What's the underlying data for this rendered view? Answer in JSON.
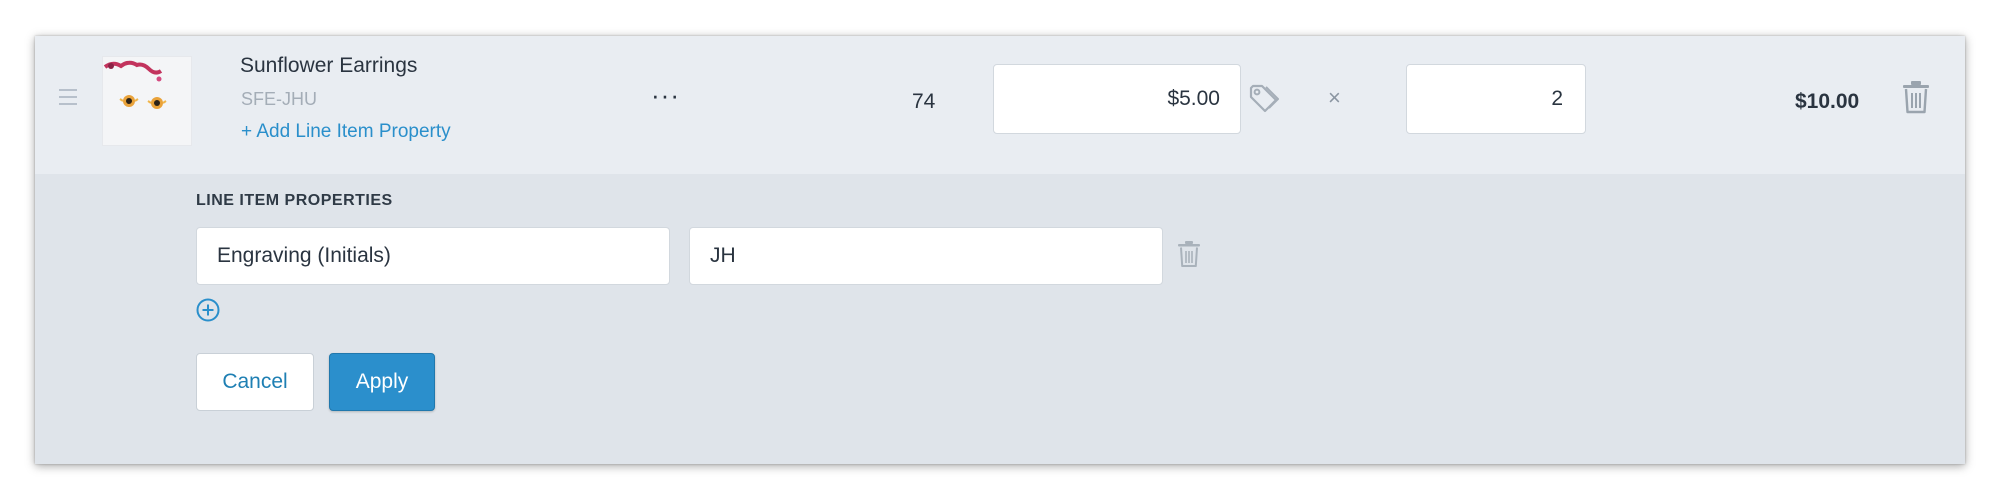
{
  "line_item": {
    "product_title": "Sunflower Earrings",
    "sku": "SFE-JHU",
    "add_property_link": "+ Add Line Item Property",
    "more_actions": "···",
    "available_qty": "74",
    "price": "$5.00",
    "multiply_symbol": "×",
    "quantity": "2",
    "line_total": "$10.00"
  },
  "properties_panel": {
    "section_title": "LINE ITEM PROPERTIES",
    "properties": [
      {
        "name": "Engraving (Initials)",
        "value": "JH"
      }
    ],
    "cancel_label": "Cancel",
    "apply_label": "Apply"
  },
  "icons": {
    "drag": "drag-handle-icon",
    "discount": "tag-icon",
    "delete": "trash-icon",
    "add": "plus-circle-icon"
  },
  "colors": {
    "accent": "#2b8fcc",
    "link": "#2a8fcb",
    "panel_bg": "#dfe4ea",
    "row_bg": "#e9edf2"
  }
}
